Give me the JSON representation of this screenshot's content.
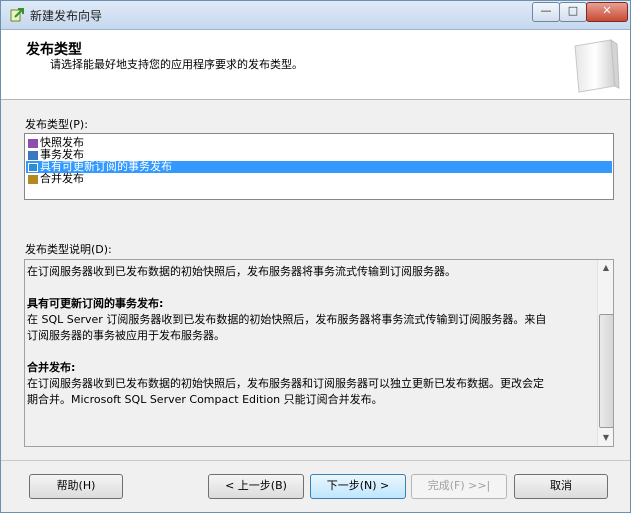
{
  "window": {
    "title": "新建发布向导"
  },
  "header": {
    "title": "发布类型",
    "subtitle": "请选择能最好地支持您的应用程序要求的发布类型。"
  },
  "publication_types": {
    "label": "发布类型(P):",
    "items": [
      {
        "label": "快照发布",
        "icon": "snapshot-publication-icon",
        "color": "#8c4fb0"
      },
      {
        "label": "事务发布",
        "icon": "transactional-publication-icon",
        "color": "#3a78c2"
      },
      {
        "label": "具有可更新订阅的事务发布",
        "icon": "updatable-subscription-icon",
        "color": "#2f8fd0"
      },
      {
        "label": "合并发布",
        "icon": "merge-publication-icon",
        "color": "#b48a1e"
      }
    ],
    "selected_index": 2
  },
  "description": {
    "label": "发布类型说明(D):",
    "intro": "在订阅服务器收到已发布数据的初始快照后，发布服务器将事务流式传输到订阅服务器。",
    "sections": [
      {
        "heading": "具有可更新订阅的事务发布:",
        "lines": [
          "在 SQL Server 订阅服务器收到已发布数据的初始快照后，发布服务器将事务流式传输到订阅服务器。来自",
          "订阅服务器的事务被应用于发布服务器。"
        ]
      },
      {
        "heading": "合并发布:",
        "lines": [
          "在订阅服务器收到已发布数据的初始快照后，发布服务器和订阅服务器可以独立更新已发布数据。更改会定",
          "期合并。Microsoft SQL Server Compact Edition 只能订阅合并发布。"
        ]
      }
    ]
  },
  "buttons": {
    "help": "帮助(H)",
    "back": "< 上一步(B)",
    "next": "下一步(N) >",
    "finish": "完成(F) >>|",
    "cancel": "取消"
  },
  "title_controls": {
    "minimize": "—",
    "maximize": "□",
    "close": "✕"
  }
}
